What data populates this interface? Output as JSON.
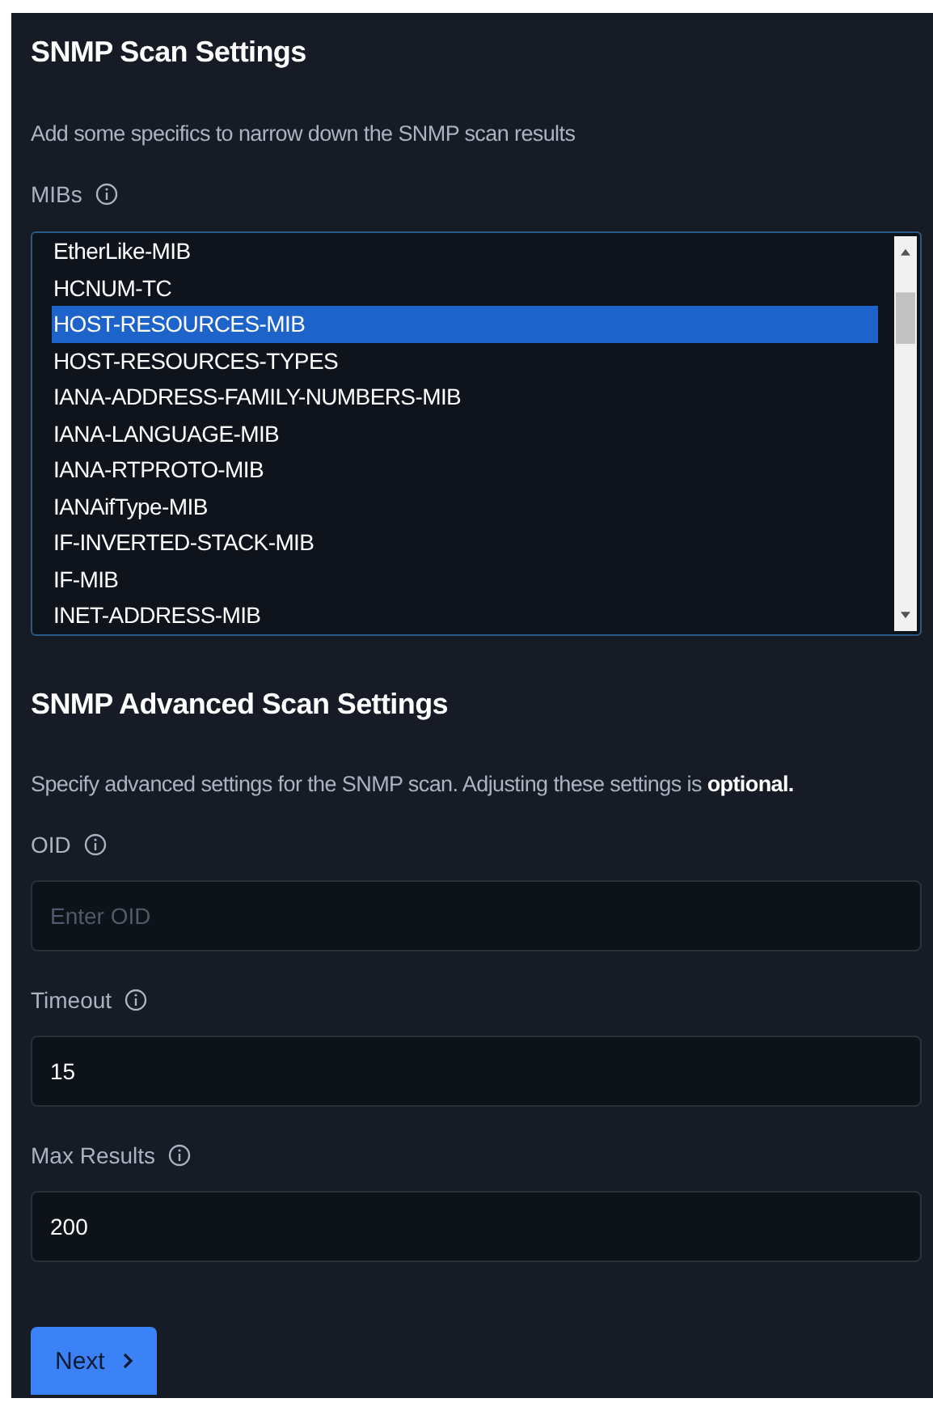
{
  "scan_settings": {
    "title": "SNMP Scan Settings",
    "description": "Add some specifics to narrow down the SNMP scan results",
    "mibs": {
      "label": "MIBs",
      "items": [
        {
          "label": "EtherLike-MIB",
          "selected": false
        },
        {
          "label": "HCNUM-TC",
          "selected": false
        },
        {
          "label": "HOST-RESOURCES-MIB",
          "selected": true
        },
        {
          "label": "HOST-RESOURCES-TYPES",
          "selected": false
        },
        {
          "label": "IANA-ADDRESS-FAMILY-NUMBERS-MIB",
          "selected": false
        },
        {
          "label": "IANA-LANGUAGE-MIB",
          "selected": false
        },
        {
          "label": "IANA-RTPROTO-MIB",
          "selected": false
        },
        {
          "label": "IANAifType-MIB",
          "selected": false
        },
        {
          "label": "IF-INVERTED-STACK-MIB",
          "selected": false
        },
        {
          "label": "IF-MIB",
          "selected": false
        },
        {
          "label": "INET-ADDRESS-MIB",
          "selected": false
        }
      ]
    }
  },
  "advanced_settings": {
    "title": "SNMP Advanced Scan Settings",
    "description": "Specify advanced settings for the SNMP scan. Adjusting these settings is **optional.**",
    "fields": [
      {
        "label": "OID",
        "placeholder": "Enter OID"
      },
      {
        "label": "Timeout",
        "value": "15"
      },
      {
        "label": "Max Results",
        "value": "200"
      }
    ]
  },
  "next_button": {
    "label": "Next"
  }
}
